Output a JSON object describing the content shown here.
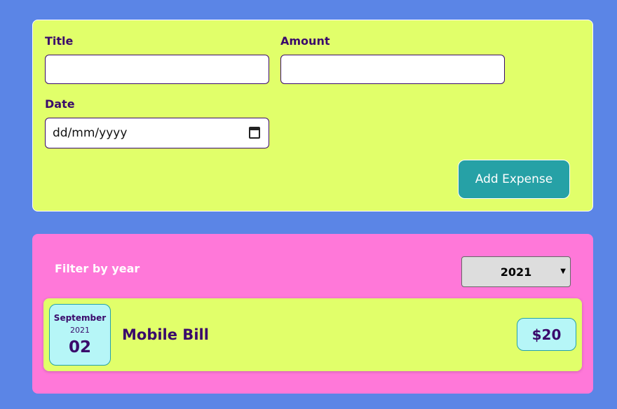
{
  "form": {
    "title_label": "Title",
    "amount_label": "Amount",
    "date_label": "Date",
    "title_value": "",
    "amount_value": "",
    "date_placeholder": "dd/mm/yyyy",
    "add_button": "Add Expense"
  },
  "filter": {
    "label": "Filter by year",
    "selected_year": "2021"
  },
  "expenses": [
    {
      "month": "September",
      "year": "2021",
      "day": "02",
      "title": "Mobile Bill",
      "amount": "$20"
    }
  ],
  "colors": {
    "background": "#5b85e6",
    "form_bg": "#e1ff6a",
    "list_bg": "#ff78d9",
    "accent": "#26a1a6",
    "text": "#3a0a6b",
    "date_box": "#b6f6f7"
  }
}
